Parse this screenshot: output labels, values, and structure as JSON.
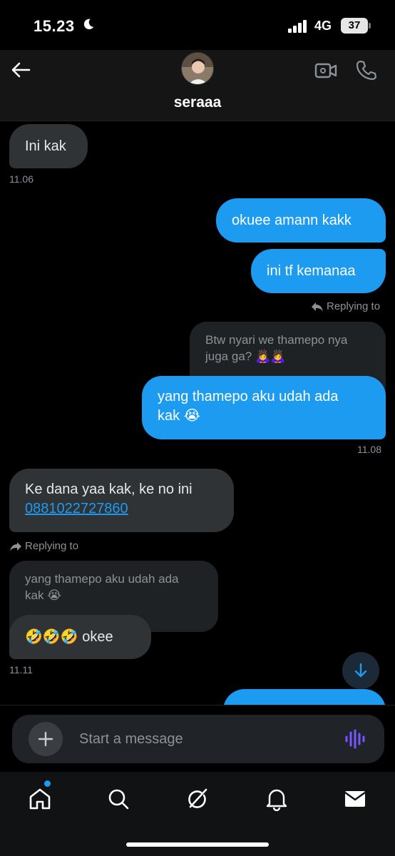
{
  "status_bar": {
    "time": "15.23",
    "network": "4G",
    "battery": "37"
  },
  "header": {
    "contact_name": "seraaa"
  },
  "messages": {
    "m1": "Ini kak",
    "t1": "11.06",
    "m2": "okuee amann kakk",
    "m3": "ini tf kemanaa",
    "reply1_label": "Replying to",
    "quote1_line1": "Btw nyari we thamepo nya",
    "quote1_line2": "juga ga? 🙇‍♀️🙇‍♀️",
    "m4_line1": "yang thamepo aku udah ada",
    "m4_line2": "kak 😭",
    "t2": "11.08",
    "m5_line1": "Ke dana yaa kak, ke no ini",
    "m5_link": "0881022727860",
    "reply2_label": "Replying to",
    "quote2_line1": "yang thamepo aku udah ada",
    "quote2_line2": "kak 😭",
    "m6": "🤣🤣🤣 okee",
    "t3": "11.11"
  },
  "composer": {
    "placeholder": "Start a message"
  },
  "colors": {
    "accent": "#1d9bf0",
    "incoming": "#2f3336",
    "background": "#000000"
  },
  "icons": [
    "moon-icon",
    "signal-icon",
    "back-arrow-icon",
    "video-call-icon",
    "phone-icon",
    "reply-icon",
    "arrow-down-icon",
    "plus-icon",
    "voice-icon",
    "home-icon",
    "search-icon",
    "grok-icon",
    "bell-icon",
    "mail-icon"
  ]
}
